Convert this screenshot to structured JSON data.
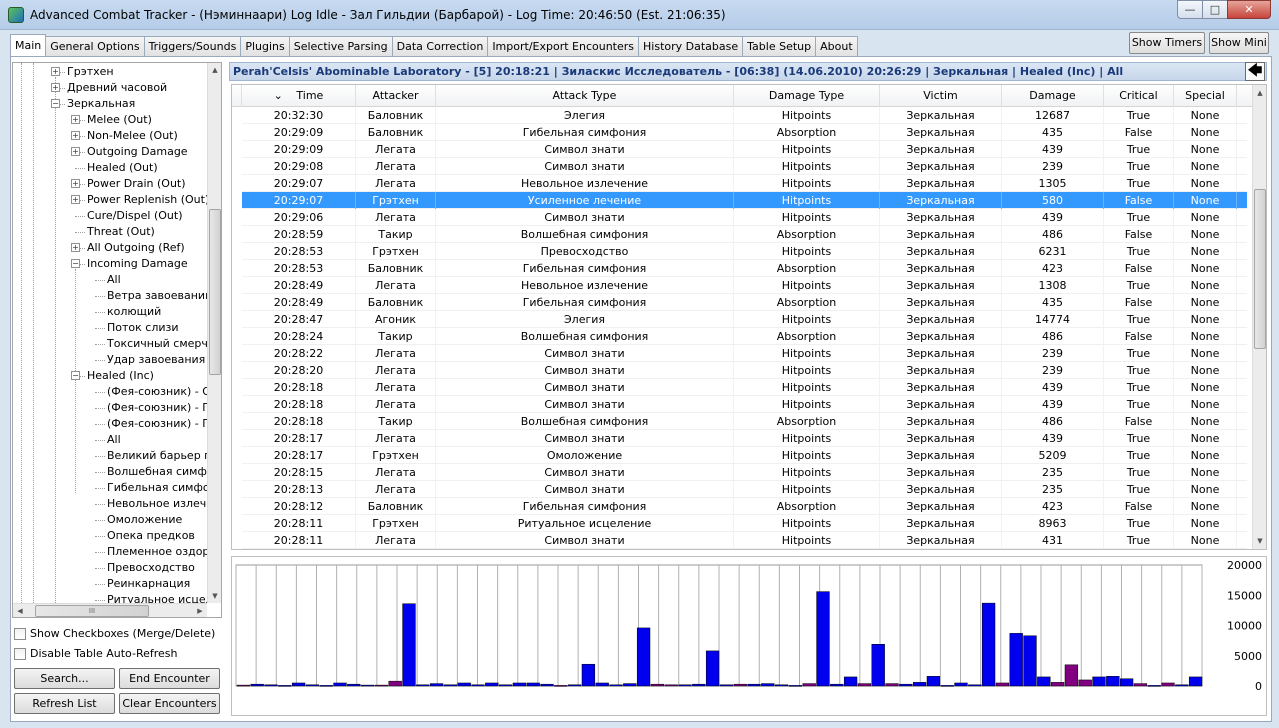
{
  "window": {
    "title": "Advanced Combat Tracker - (Нэминнаари) Log Idle - Зал Гильдии (Барбарой) - Log Time: 20:46:50 (Est. 21:06:35)",
    "minimize": "—",
    "maximize": "□",
    "close": "✕"
  },
  "tabs": [
    "Main",
    "General Options",
    "Triggers/Sounds",
    "Plugins",
    "Selective Parsing",
    "Data Correction",
    "Import/Export Encounters",
    "History Database",
    "Table Setup",
    "About"
  ],
  "top_buttons": {
    "show_timers": "Show Timers",
    "show_mini": "Show Mini"
  },
  "tree": {
    "items": [
      {
        "label": "Грэтхен",
        "expander": "+",
        "level": 2
      },
      {
        "label": "Древний часовой",
        "expander": "+",
        "level": 2
      },
      {
        "label": "Зеркальная",
        "expander": "−",
        "level": 2
      },
      {
        "label": "Melee (Out)",
        "expander": "+",
        "level": 3
      },
      {
        "label": "Non-Melee (Out)",
        "expander": "+",
        "level": 3
      },
      {
        "label": "Outgoing Damage",
        "expander": "+",
        "level": 3
      },
      {
        "label": "Healed (Out)",
        "expander": "",
        "level": 3
      },
      {
        "label": "Power Drain (Out)",
        "expander": "+",
        "level": 3
      },
      {
        "label": "Power Replenish (Out)",
        "expander": "+",
        "level": 3
      },
      {
        "label": "Cure/Dispel (Out)",
        "expander": "",
        "level": 3
      },
      {
        "label": "Threat (Out)",
        "expander": "",
        "level": 3
      },
      {
        "label": "All Outgoing (Ref)",
        "expander": "+",
        "level": 3
      },
      {
        "label": "Incoming Damage",
        "expander": "−",
        "level": 3
      },
      {
        "label": "All",
        "expander": "",
        "level": 4
      },
      {
        "label": "Ветра завоеваний",
        "expander": "",
        "level": 4
      },
      {
        "label": "колющий",
        "expander": "",
        "level": 4
      },
      {
        "label": "Поток слизи",
        "expander": "",
        "level": 4
      },
      {
        "label": "Токсичный смерч",
        "expander": "",
        "level": 4
      },
      {
        "label": "Удар завоевания",
        "expander": "",
        "level": 4
      },
      {
        "label": "Healed (Inc)",
        "expander": "−",
        "level": 3
      },
      {
        "label": "(Фея-союзник) - Оз",
        "expander": "",
        "level": 4
      },
      {
        "label": "(Фея-союзник) - По",
        "expander": "",
        "level": 4
      },
      {
        "label": "(Фея-союзник) - По",
        "expander": "",
        "level": 4
      },
      {
        "label": "All",
        "expander": "",
        "level": 4
      },
      {
        "label": "Великий барьер пр",
        "expander": "",
        "level": 4
      },
      {
        "label": "Волшебная симфон",
        "expander": "",
        "level": 4
      },
      {
        "label": "Гибельная симфони",
        "expander": "",
        "level": 4
      },
      {
        "label": "Невольное излечен",
        "expander": "",
        "level": 4
      },
      {
        "label": "Омоложение",
        "expander": "",
        "level": 4
      },
      {
        "label": "Опека предков",
        "expander": "",
        "level": 4
      },
      {
        "label": "Племенное оздоро",
        "expander": "",
        "level": 4
      },
      {
        "label": "Превосходство",
        "expander": "",
        "level": 4
      },
      {
        "label": "Реинкарнация",
        "expander": "",
        "level": 4
      },
      {
        "label": "Ритуальное исцеле",
        "expander": "",
        "level": 4
      }
    ],
    "scroll_up": "▲",
    "scroll_down": "▼",
    "scroll_left": "◀",
    "scroll_right": "▶",
    "hthumb_grip": "III"
  },
  "options": {
    "show_checkboxes": "Show Checkboxes (Merge/Delete)",
    "disable_refresh": "Disable Table Auto-Refresh"
  },
  "buttons": {
    "search": "Search...",
    "end_encounter": "End Encounter",
    "refresh_list": "Refresh List",
    "clear_encounters": "Clear Encounters"
  },
  "encounter_header": "Perah'Celsis' Abominable Laboratory - [5] 20:18:21 | Зиласкис Исследователь - [06:38] (14.06.2010) 20:26:29 | Зеркальная | Healed (Inc) | All",
  "back_icon": "🡄",
  "table": {
    "sort_indicator": "⌄",
    "columns": [
      "Time",
      "Attacker",
      "Attack Type",
      "Damage Type",
      "Victim",
      "Damage",
      "Critical",
      "Special"
    ],
    "selected_index": 5,
    "rows": [
      [
        "20:32:30",
        "Баловник",
        "Элегия",
        "Hitpoints",
        "Зеркальная",
        "12687",
        "True",
        "None"
      ],
      [
        "20:29:09",
        "Баловник",
        "Гибельная симфония",
        "Absorption",
        "Зеркальная",
        "435",
        "False",
        "None"
      ],
      [
        "20:29:09",
        "Легата",
        "Символ знати",
        "Hitpoints",
        "Зеркальная",
        "439",
        "True",
        "None"
      ],
      [
        "20:29:08",
        "Легата",
        "Символ знати",
        "Hitpoints",
        "Зеркальная",
        "239",
        "True",
        "None"
      ],
      [
        "20:29:07",
        "Легата",
        "Невольное излечение",
        "Hitpoints",
        "Зеркальная",
        "1305",
        "True",
        "None"
      ],
      [
        "20:29:07",
        "Грэтхен",
        "Усиленное лечение",
        "Hitpoints",
        "Зеркальная",
        "580",
        "False",
        "None"
      ],
      [
        "20:29:06",
        "Легата",
        "Символ знати",
        "Hitpoints",
        "Зеркальная",
        "439",
        "True",
        "None"
      ],
      [
        "20:28:59",
        "Такир",
        "Волшебная симфония",
        "Absorption",
        "Зеркальная",
        "486",
        "False",
        "None"
      ],
      [
        "20:28:53",
        "Грэтхен",
        "Превосходство",
        "Hitpoints",
        "Зеркальная",
        "6231",
        "True",
        "None"
      ],
      [
        "20:28:53",
        "Баловник",
        "Гибельная симфония",
        "Absorption",
        "Зеркальная",
        "423",
        "False",
        "None"
      ],
      [
        "20:28:49",
        "Легата",
        "Невольное излечение",
        "Hitpoints",
        "Зеркальная",
        "1308",
        "True",
        "None"
      ],
      [
        "20:28:49",
        "Баловник",
        "Гибельная симфония",
        "Absorption",
        "Зеркальная",
        "435",
        "False",
        "None"
      ],
      [
        "20:28:47",
        "Агоник",
        "Элегия",
        "Hitpoints",
        "Зеркальная",
        "14774",
        "True",
        "None"
      ],
      [
        "20:28:24",
        "Такир",
        "Волшебная симфония",
        "Absorption",
        "Зеркальная",
        "486",
        "False",
        "None"
      ],
      [
        "20:28:22",
        "Легата",
        "Символ знати",
        "Hitpoints",
        "Зеркальная",
        "239",
        "True",
        "None"
      ],
      [
        "20:28:20",
        "Легата",
        "Символ знати",
        "Hitpoints",
        "Зеркальная",
        "239",
        "True",
        "None"
      ],
      [
        "20:28:18",
        "Легата",
        "Символ знати",
        "Hitpoints",
        "Зеркальная",
        "439",
        "True",
        "None"
      ],
      [
        "20:28:18",
        "Легата",
        "Символ знати",
        "Hitpoints",
        "Зеркальная",
        "439",
        "True",
        "None"
      ],
      [
        "20:28:18",
        "Такир",
        "Волшебная симфония",
        "Absorption",
        "Зеркальная",
        "486",
        "False",
        "None"
      ],
      [
        "20:28:17",
        "Легата",
        "Символ знати",
        "Hitpoints",
        "Зеркальная",
        "439",
        "True",
        "None"
      ],
      [
        "20:28:17",
        "Грэтхен",
        "Омоложение",
        "Hitpoints",
        "Зеркальная",
        "5209",
        "True",
        "None"
      ],
      [
        "20:28:15",
        "Легата",
        "Символ знати",
        "Hitpoints",
        "Зеркальная",
        "235",
        "True",
        "None"
      ],
      [
        "20:28:13",
        "Легата",
        "Символ знати",
        "Hitpoints",
        "Зеркальная",
        "235",
        "True",
        "None"
      ],
      [
        "20:28:12",
        "Баловник",
        "Гибельная симфония",
        "Absorption",
        "Зеркальная",
        "423",
        "False",
        "None"
      ],
      [
        "20:28:11",
        "Грэтхен",
        "Ритуальное исцеление",
        "Hitpoints",
        "Зеркальная",
        "8963",
        "True",
        "None"
      ],
      [
        "20:28:11",
        "Легата",
        "Символ знати",
        "Hitpoints",
        "Зеркальная",
        "431",
        "True",
        "None"
      ]
    ]
  },
  "graph": {
    "y_ticks": [
      "20000",
      "15000",
      "10000",
      "5000",
      "0"
    ],
    "ymax": 20000,
    "color_hitpoints": "#0000ee",
    "color_absorption": "#800080",
    "bars": [
      {
        "v": 150,
        "c": "a"
      },
      {
        "v": 300,
        "c": "h"
      },
      {
        "v": 200,
        "c": "h"
      },
      {
        "v": 100,
        "c": "h"
      },
      {
        "v": 500,
        "c": "h"
      },
      {
        "v": 200,
        "c": "h"
      },
      {
        "v": 100,
        "c": "h"
      },
      {
        "v": 500,
        "c": "h"
      },
      {
        "v": 300,
        "c": "h"
      },
      {
        "v": 150,
        "c": "h"
      },
      {
        "v": 150,
        "c": "a"
      },
      {
        "v": 800,
        "c": "a"
      },
      {
        "v": 13600,
        "c": "h"
      },
      {
        "v": 200,
        "c": "h"
      },
      {
        "v": 400,
        "c": "h"
      },
      {
        "v": 200,
        "c": "h"
      },
      {
        "v": 500,
        "c": "h"
      },
      {
        "v": 200,
        "c": "h"
      },
      {
        "v": 500,
        "c": "h"
      },
      {
        "v": 200,
        "c": "h"
      },
      {
        "v": 500,
        "c": "h"
      },
      {
        "v": 500,
        "c": "h"
      },
      {
        "v": 300,
        "c": "h"
      },
      {
        "v": 100,
        "c": "a"
      },
      {
        "v": 200,
        "c": "h"
      },
      {
        "v": 3600,
        "c": "h"
      },
      {
        "v": 500,
        "c": "h"
      },
      {
        "v": 200,
        "c": "h"
      },
      {
        "v": 400,
        "c": "h"
      },
      {
        "v": 9600,
        "c": "h"
      },
      {
        "v": 300,
        "c": "a"
      },
      {
        "v": 200,
        "c": "a"
      },
      {
        "v": 200,
        "c": "h"
      },
      {
        "v": 300,
        "c": "h"
      },
      {
        "v": 5800,
        "c": "h"
      },
      {
        "v": 200,
        "c": "h"
      },
      {
        "v": 300,
        "c": "a"
      },
      {
        "v": 300,
        "c": "h"
      },
      {
        "v": 400,
        "c": "h"
      },
      {
        "v": 200,
        "c": "h"
      },
      {
        "v": 100,
        "c": "h"
      },
      {
        "v": 400,
        "c": "a"
      },
      {
        "v": 15600,
        "c": "h"
      },
      {
        "v": 300,
        "c": "h"
      },
      {
        "v": 1500,
        "c": "h"
      },
      {
        "v": 400,
        "c": "a"
      },
      {
        "v": 6900,
        "c": "h"
      },
      {
        "v": 400,
        "c": "a"
      },
      {
        "v": 300,
        "c": "h"
      },
      {
        "v": 600,
        "c": "h"
      },
      {
        "v": 1600,
        "c": "h"
      },
      {
        "v": 100,
        "c": "h"
      },
      {
        "v": 500,
        "c": "h"
      },
      {
        "v": 200,
        "c": "h"
      },
      {
        "v": 13700,
        "c": "h"
      },
      {
        "v": 500,
        "c": "a"
      },
      {
        "v": 8700,
        "c": "h"
      },
      {
        "v": 8300,
        "c": "h"
      },
      {
        "v": 1500,
        "c": "h"
      },
      {
        "v": 600,
        "c": "a"
      },
      {
        "v": 3500,
        "c": "a"
      },
      {
        "v": 1000,
        "c": "a"
      },
      {
        "v": 1500,
        "c": "h"
      },
      {
        "v": 1600,
        "c": "h"
      },
      {
        "v": 1200,
        "c": "h"
      },
      {
        "v": 400,
        "c": "a"
      },
      {
        "v": 100,
        "c": "h"
      },
      {
        "v": 500,
        "c": "a"
      },
      {
        "v": 200,
        "c": "h"
      },
      {
        "v": 1500,
        "c": "h"
      }
    ]
  }
}
